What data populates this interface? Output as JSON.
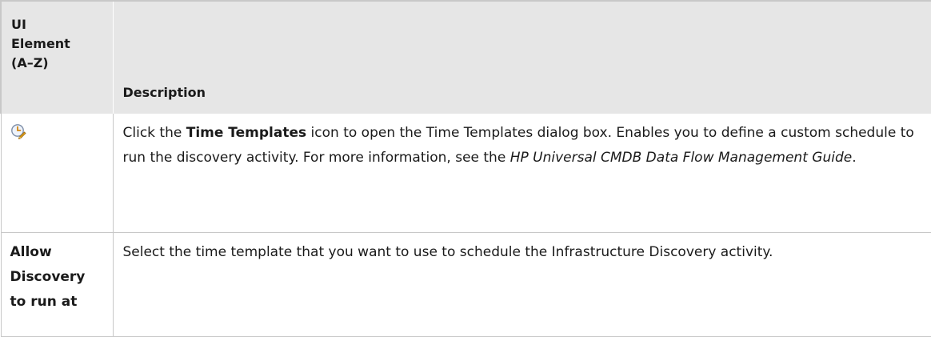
{
  "table": {
    "headers": {
      "element": [
        "UI",
        "Element",
        "(A–Z)"
      ],
      "description": "Description"
    },
    "rows": [
      {
        "element_icon": "time-templates-icon",
        "description": {
          "prefix": "Click the ",
          "strong": "Time Templates",
          "middle": " icon to open the Time Templates dialog box. Enables you to define a custom schedule to run the discovery activity. For more information, see the ",
          "emphasis": "HP Universal CMDB Data Flow Management Guide",
          "suffix": "."
        }
      },
      {
        "element_label": [
          "Allow",
          "Discovery",
          "to run at"
        ],
        "description": "Select the time template that you want to use to schedule the Infrastructure Discovery activity."
      }
    ]
  },
  "colors": {
    "header_bg": "#e6e6e6",
    "border": "#c8c8c8",
    "text": "#1a1a1a"
  }
}
